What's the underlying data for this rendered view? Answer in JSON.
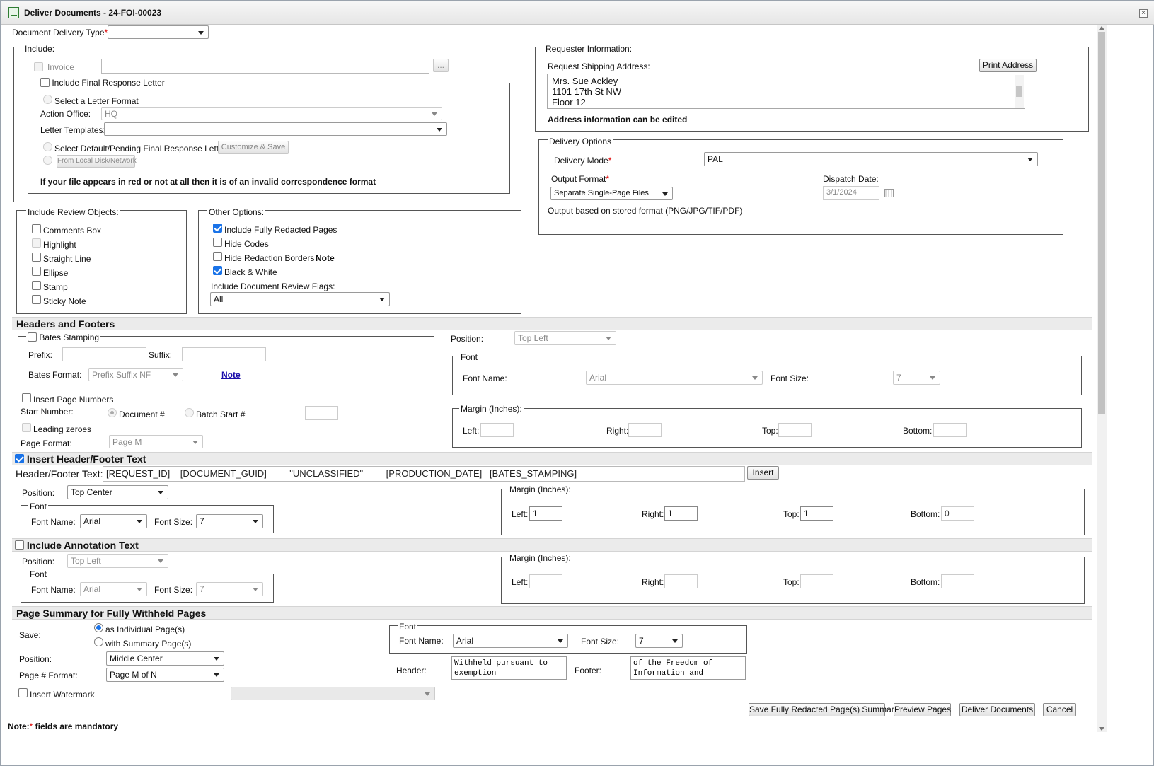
{
  "window": {
    "title": "Deliver Documents - 24-FOI-00023",
    "close": "×"
  },
  "delivery_type": {
    "label": "Document Delivery Type",
    "required": "*",
    "value": ""
  },
  "include": {
    "legend": "Include:",
    "invoice": "Invoice",
    "browse": "...",
    "final_letter": "Include Final Response Letter",
    "select_format": "Select a Letter Format",
    "action_office_label": "Action Office:",
    "action_office_value": "HQ",
    "letter_templates_label": "Letter Templates:",
    "select_default": "Select Default/Pending Final Response Letter",
    "customize": "Customize & Save",
    "from_local": "From Local Disk/Network",
    "warning": "If your file appears in red or not at all then it is of an invalid correspondence format"
  },
  "requester": {
    "legend": "Requester Information:",
    "shipping_label": "Request Shipping Address:",
    "print": "Print Address",
    "address": [
      "Mrs. Sue Ackley",
      "1101 17th St NW",
      "Floor 12"
    ],
    "editable_note": "Address information can be edited"
  },
  "delivery_options": {
    "legend": "Delivery Options",
    "mode_label": "Delivery Mode",
    "required": "*",
    "mode_value": "PAL",
    "output_label": "Output Format",
    "output_value": "Separate Single-Page Files",
    "dispatch_label": "Dispatch Date:",
    "dispatch_value": "3/1/2024",
    "output_note": "Output based on stored format (PNG/JPG/TIF/PDF)"
  },
  "review_objects": {
    "legend": "Include Review Objects:",
    "items": [
      "Comments Box",
      "Highlight",
      "Straight Line",
      "Ellipse",
      "Stamp",
      "Sticky Note"
    ]
  },
  "other_options": {
    "legend": "Other Options:",
    "fully_redacted": "Include Fully Redacted Pages",
    "hide_codes": "Hide Codes",
    "hide_borders": "Hide Redaction Borders",
    "note": "Note",
    "black_white": "Black & White",
    "flags_label": "Include Document Review Flags:",
    "flags_value": "All"
  },
  "headers_footers": {
    "title": "Headers and Footers",
    "bates": "Bates Stamping",
    "prefix": "Prefix:",
    "suffix": "Suffix:",
    "bates_format_label": "Bates Format:",
    "bates_format_value": "Prefix Suffix NF",
    "note": "Note",
    "position_label": "Position:",
    "position_value": "Top Left",
    "font_legend": "Font",
    "font_name_label": "Font Name:",
    "font_name_value": "Arial",
    "font_size_label": "Font Size:",
    "font_size_value": "7",
    "margin_legend": "Margin (Inches):",
    "left": "Left:",
    "right": "Right:",
    "top": "Top:",
    "bottom": "Bottom:",
    "page_numbers": "Insert Page Numbers",
    "start_number": "Start Number:",
    "document_num": "Document #",
    "batch_start": "Batch Start #",
    "leading_zeroes": "Leading zeroes",
    "page_format_label": "Page Format:",
    "page_format_value": "Page M"
  },
  "header_text": {
    "title": "Insert Header/Footer Text",
    "label": "Header/Footer Text:",
    "value": "[REQUEST_ID]    [DOCUMENT_GUID]         \"UNCLASSIFIED\"         [PRODUCTION_DATE]   [BATES_STAMPING]",
    "insert": "Insert",
    "position_label": "Position:",
    "position_value": "Top Center",
    "font_legend": "Font",
    "font_name_label": "Font Name:",
    "font_name_value": "Arial",
    "font_size_label": "Font Size:",
    "font_size_value": "7",
    "margin_legend": "Margin (Inches):",
    "left": "Left:",
    "right": "Right:",
    "top": "Top:",
    "bottom": "Bottom:",
    "left_value": "1",
    "right_value": "1",
    "top_value": "1",
    "bottom_value": "0"
  },
  "annotation": {
    "title": "Include Annotation Text",
    "position_label": "Position:",
    "position_value": "Top Left",
    "font_legend": "Font",
    "font_name_label": "Font Name:",
    "font_name_value": "Arial",
    "font_size_label": "Font Size:",
    "font_size_value": "7",
    "margin_legend": "Margin (Inches):",
    "left": "Left:",
    "right": "Right:",
    "top": "Top:",
    "bottom": "Bottom:"
  },
  "page_summary": {
    "title": "Page Summary for Fully Withheld Pages",
    "save_label": "Save:",
    "individual": "as Individual Page(s)",
    "summary": "with Summary Page(s)",
    "position_label": "Position:",
    "position_value": "Middle Center",
    "page_format_label": "Page # Format:",
    "page_format_value": "Page M of N",
    "font_legend": "Font",
    "font_name_label": "Font Name:",
    "font_name_value": "Arial",
    "font_size_label": "Font Size:",
    "font_size_value": "7",
    "header_label": "Header:",
    "header_value": "Withheld pursuant to exemption",
    "footer_label": "Footer:",
    "footer_value": "of the Freedom of Information and"
  },
  "watermark": {
    "label": "Insert Watermark"
  },
  "actions": {
    "save_summary": "Save Fully Redacted Page(s) Summary",
    "preview": "Preview Pages",
    "deliver": "Deliver Documents",
    "cancel": "Cancel"
  },
  "footer_note": {
    "prefix": "Note:",
    "star": "*",
    "text": " fields are mandatory"
  }
}
